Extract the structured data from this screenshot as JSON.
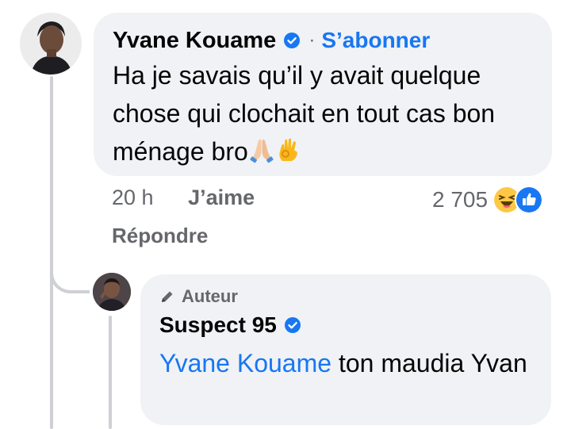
{
  "comment": {
    "author": "Yvane Kouame",
    "separator": "·",
    "follow_label": "S’abonner",
    "text": "Ha je savais qu’il y avait quelque chose qui clochait en tout cas bon ménage bro",
    "emojis": [
      "folded-hands-icon",
      "ok-hand-icon"
    ],
    "time": "20 h",
    "like_label": "J’aime",
    "reply_label": "Répondre",
    "reaction_count": "2 705",
    "reaction_icons": [
      "haha-reaction-icon",
      "like-reaction-icon"
    ]
  },
  "reply": {
    "badge_label": "Auteur",
    "author": "Suspect 95",
    "mention": "Yvane Kouame",
    "text": " ton maudia Yvan"
  },
  "colors": {
    "link_blue": "#1877f2",
    "bubble_bg": "#f0f2f5",
    "muted_text": "#65676b",
    "thread_line": "#ced0d4"
  }
}
